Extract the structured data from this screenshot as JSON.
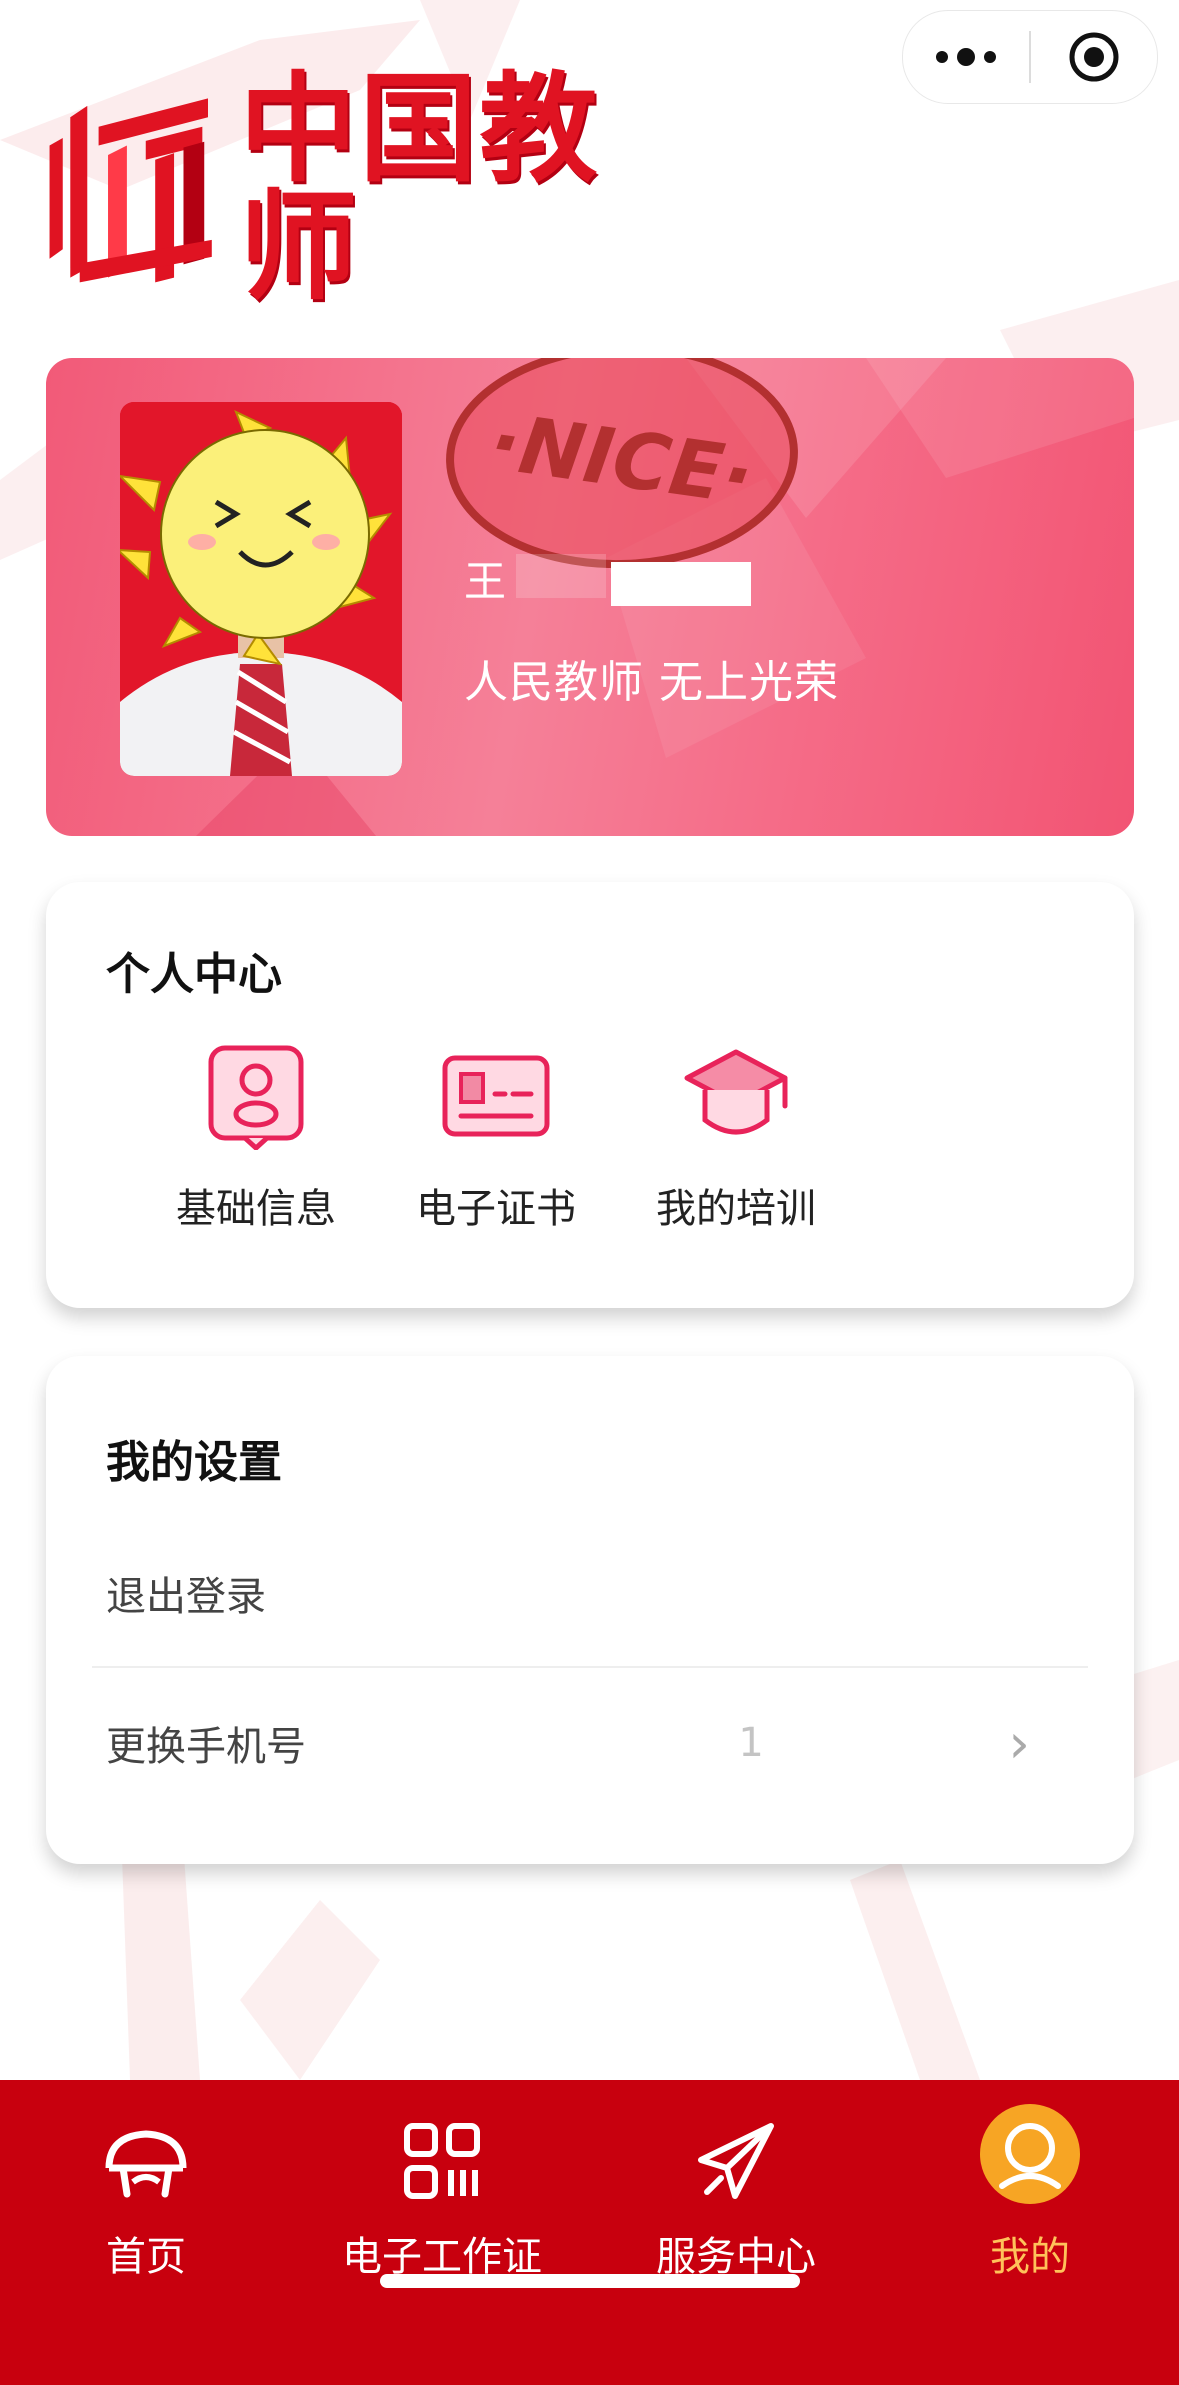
{
  "capsule": {
    "more_icon": "ellipsis-icon",
    "close_icon": "target-icon"
  },
  "brand": {
    "title": "中国教师",
    "logo_icon": "teacher-logo-icon"
  },
  "profile": {
    "name_prefix": "王",
    "slogan": "人民教师   无上光荣",
    "stamp_text": "·NICE·"
  },
  "personal_center": {
    "title": "个人中心",
    "items": [
      {
        "label": "基础信息",
        "icon": "profile-card-icon"
      },
      {
        "label": "电子证书",
        "icon": "certificate-icon"
      },
      {
        "label": "我的培训",
        "icon": "graduation-cap-icon"
      }
    ]
  },
  "settings": {
    "title": "我的设置",
    "logout_label": "退出登录",
    "change_phone_label": "更换手机号",
    "phone_value": "1"
  },
  "tabbar": {
    "items": [
      {
        "label": "首页",
        "icon": "home-icon"
      },
      {
        "label": "电子工作证",
        "icon": "qrcode-icon"
      },
      {
        "label": "服务中心",
        "icon": "paper-plane-icon"
      },
      {
        "label": "我的",
        "icon": "user-avatar-icon",
        "active": true
      }
    ]
  },
  "colors": {
    "brand_red": "#e01322",
    "tabbar_red": "#c8000e",
    "active_tab": "#ffc25a",
    "banner_pink": "#f58098",
    "icon_pink": "#e8235a"
  }
}
